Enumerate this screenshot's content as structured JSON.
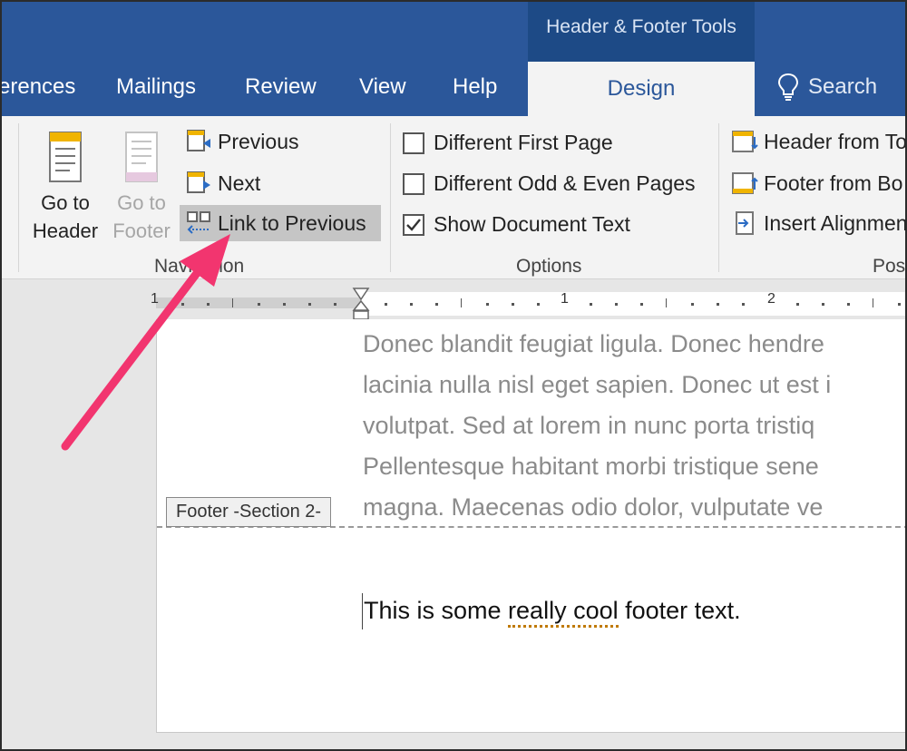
{
  "ribbon": {
    "contextual_group": "Header & Footer Tools",
    "tabs": [
      "erences",
      "Mailings",
      "Review",
      "View",
      "Help"
    ],
    "active_tab": "Design",
    "search_label": "Search"
  },
  "navigation_group": {
    "label": "Navigation",
    "go_to_header": [
      "Go to",
      "Header"
    ],
    "go_to_footer": [
      "Go to",
      "Footer"
    ],
    "previous": "Previous",
    "next": "Next",
    "link_to_previous": "Link to Previous"
  },
  "options_group": {
    "label": "Options",
    "items": [
      {
        "label": "Different First Page",
        "checked": false
      },
      {
        "label": "Different Odd & Even Pages",
        "checked": false
      },
      {
        "label": "Show Document Text",
        "checked": true
      }
    ]
  },
  "position_group": {
    "label": "Pos",
    "items": [
      "Header from To",
      "Footer from Bo",
      "Insert Alignmen"
    ]
  },
  "ruler": {
    "labels": [
      "1",
      "1",
      "2"
    ]
  },
  "document": {
    "body_lines": [
      "Donec blandit feugiat ligula. Donec hendre",
      "lacinia nulla nisl eget sapien. Donec ut est i",
      "volutpat. Sed at lorem in nunc porta tristiq",
      "Pellentesque habitant morbi tristique sene",
      "magna. Maecenas odio dolor, vulputate ve"
    ],
    "footer_tag": "Footer -Section 2-",
    "footer_text_before": "This is some ",
    "footer_text_flagged": "really cool",
    "footer_text_after": " footer text."
  },
  "colors": {
    "ribbon_blue": "#2b579a",
    "contextual_blue": "#1d4a86",
    "annotation_arrow": "#f2356f"
  }
}
